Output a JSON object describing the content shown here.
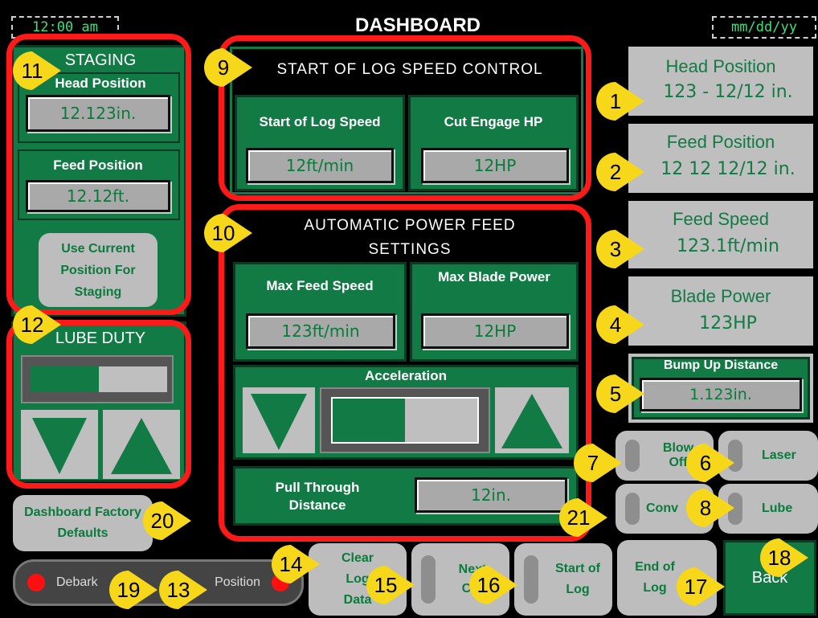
{
  "header": {
    "time": "12:00 am",
    "title": "DASHBOARD",
    "date": "mm/dd/yy"
  },
  "staging": {
    "title": "STAGING",
    "head_label": "Head Position",
    "head_value": "12.123in.",
    "feed_label": "Feed Position",
    "feed_value": "12.12ft.",
    "use_current": "Use Current Position For Staging"
  },
  "lube": {
    "title": "LUBE DUTY",
    "level": 0.5
  },
  "start_log": {
    "title": "START OF LOG SPEED CONTROL",
    "speed_label": "Start of Log Speed",
    "speed_value": "12ft/min",
    "hp_label": "Cut Engage HP",
    "hp_value": "12HP"
  },
  "apf": {
    "title": "AUTOMATIC POWER FEED SETTINGS",
    "max_feed_label": "Max Feed Speed",
    "max_feed_value": "123ft/min",
    "max_blade_label": "Max Blade Power",
    "max_blade_value": "12HP",
    "accel_label": "Acceleration",
    "accel_level": 0.5,
    "pull_label": "Pull Through Distance",
    "pull_value": "12in."
  },
  "readouts": {
    "head_title": "Head Position",
    "head_value": "123 - 12/12 in.",
    "feed_title": "Feed Position",
    "feed_value": "12 12 12/12 in.",
    "speed_title": "Feed Speed",
    "speed_value": "123.1ft/min",
    "blade_title": "Blade Power",
    "blade_value": "123HP",
    "bump_title": "Bump Up Distance",
    "bump_value": "1.123in."
  },
  "buttons": {
    "blow_off": "Blow Off",
    "laser": "Laser",
    "conveyor": "Conv",
    "lube": "Lube",
    "defaults": "Dashboard Factory Defaults",
    "debark": "Debark",
    "position": "Position",
    "clear_log": "Clear Log Data",
    "next_cut": "Next Cut",
    "start_log": "Start of Log",
    "end_log": "End of Log",
    "back": "Back"
  },
  "markers": [
    "1",
    "2",
    "3",
    "4",
    "5",
    "6",
    "7",
    "8",
    "9",
    "10",
    "11",
    "12",
    "13",
    "14",
    "15",
    "16",
    "17",
    "18",
    "19",
    "20",
    "21"
  ],
  "colors": {
    "panel": "#127a45",
    "highlight": "#ff1a1a",
    "marker": "#f7d71a",
    "readout_bg": "#bfbfbf"
  }
}
